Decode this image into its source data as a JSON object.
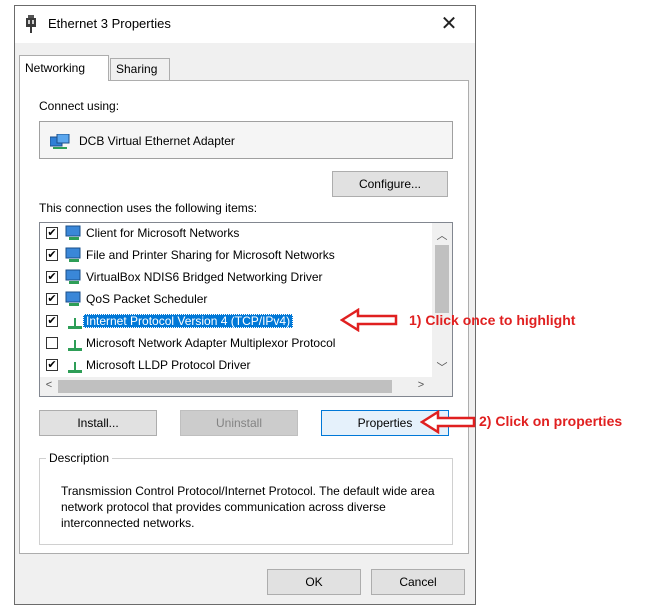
{
  "window": {
    "title": "Ethernet 3 Properties",
    "close_glyph": "✕"
  },
  "tabs": [
    {
      "label": "Networking",
      "active": true
    },
    {
      "label": "Sharing",
      "active": false
    }
  ],
  "connect_using": {
    "label": "Connect using:",
    "adapter": "DCB Virtual Ethernet Adapter",
    "icon": "network-adapter-icon"
  },
  "configure_button": "Configure...",
  "items_label": "This connection uses the following items:",
  "items": [
    {
      "label": "Client for Microsoft Networks",
      "checked": true,
      "icon": "network-client-icon"
    },
    {
      "label": "File and Printer Sharing for Microsoft Networks",
      "checked": true,
      "icon": "network-service-icon"
    },
    {
      "label": "VirtualBox NDIS6 Bridged Networking Driver",
      "checked": true,
      "icon": "network-service-icon"
    },
    {
      "label": "QoS Packet Scheduler",
      "checked": true,
      "icon": "network-service-icon"
    },
    {
      "label": "Internet Protocol Version 4 (TCP/IPv4)",
      "checked": true,
      "selected": true,
      "icon": "protocol-icon"
    },
    {
      "label": "Microsoft Network Adapter Multiplexor Protocol",
      "checked": false,
      "icon": "protocol-icon"
    },
    {
      "label": "Microsoft LLDP Protocol Driver",
      "checked": true,
      "icon": "protocol-icon"
    }
  ],
  "buttons": {
    "install": "Install...",
    "uninstall": "Uninstall",
    "properties": "Properties",
    "ok": "OK",
    "cancel": "Cancel"
  },
  "description": {
    "title": "Description",
    "text": "Transmission Control Protocol/Internet Protocol. The default wide area network protocol that provides communication across diverse interconnected networks."
  },
  "annotations": {
    "step1": "1) Click once to highlight",
    "step2": "2) Click on properties",
    "color": "#e02020"
  },
  "colors": {
    "selection": "#0078d7",
    "focus_border": "#0078d7"
  }
}
